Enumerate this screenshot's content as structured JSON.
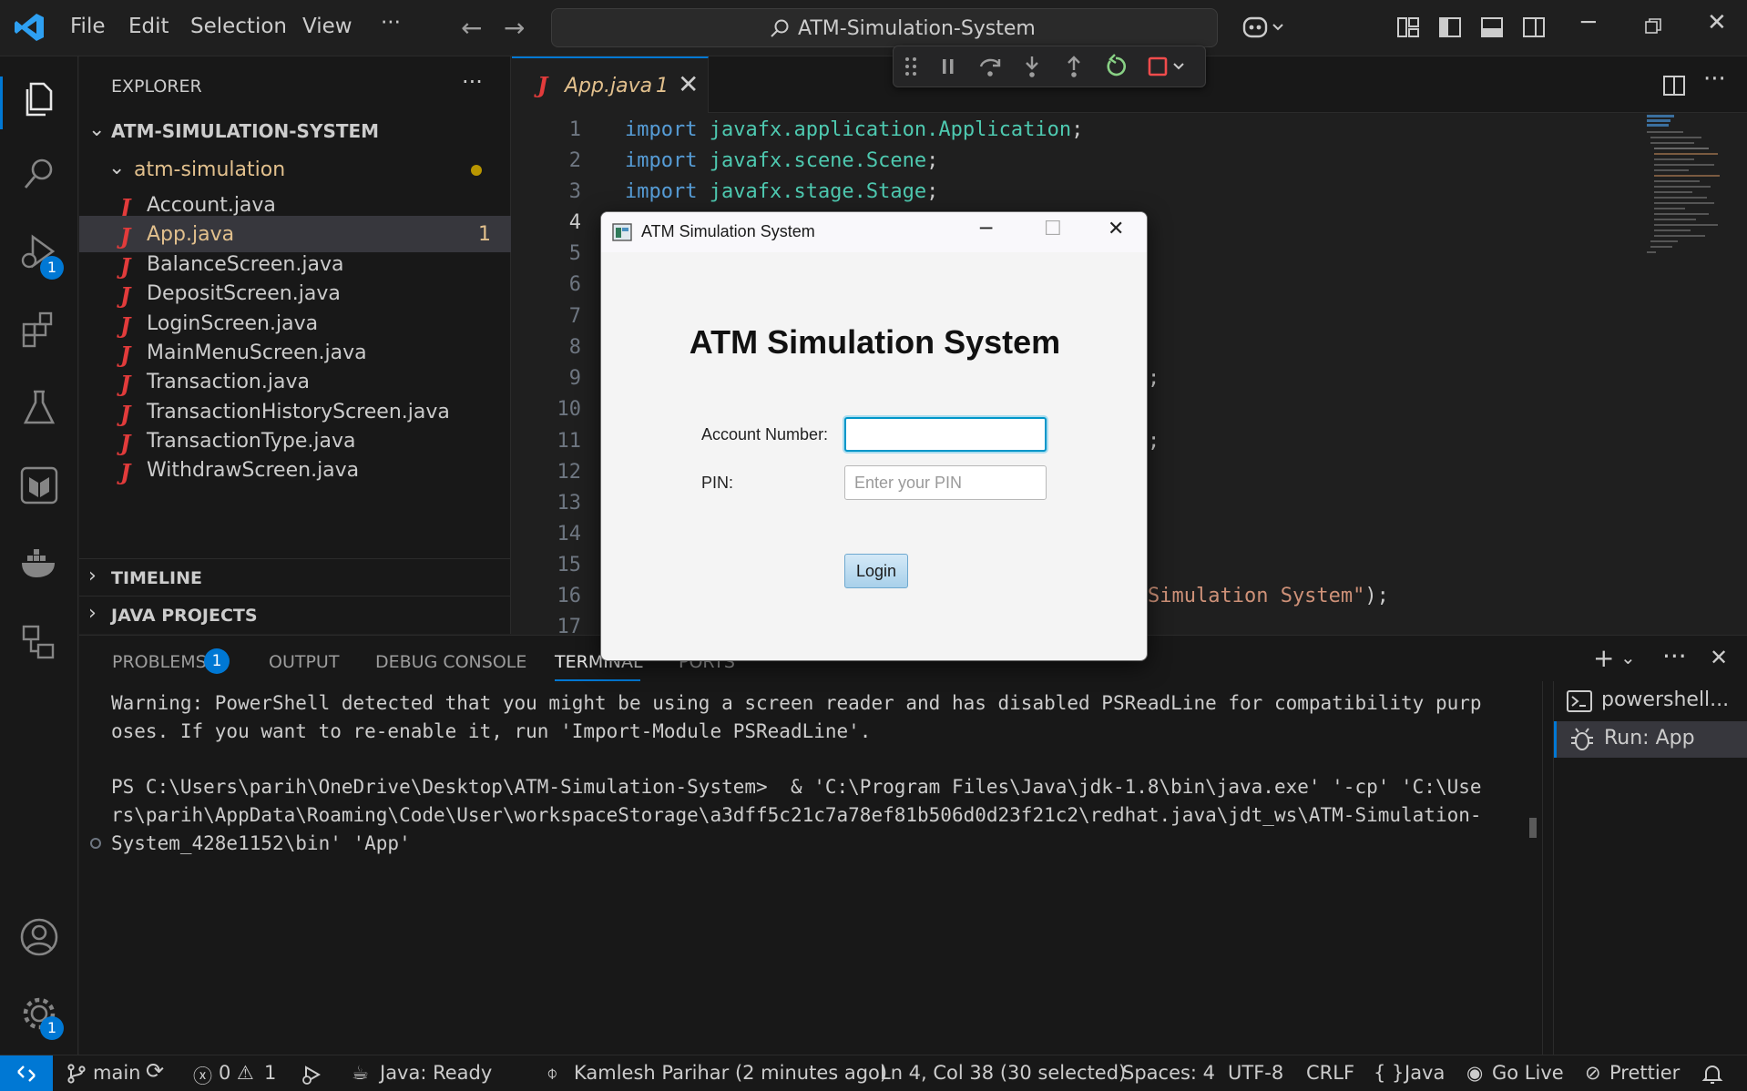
{
  "window": {
    "menu": [
      "File",
      "Edit",
      "Selection",
      "View",
      "···"
    ],
    "search_text": "ATM-Simulation-System"
  },
  "activity_bar": {
    "run_debug_badge": "1",
    "settings_badge": "1"
  },
  "explorer": {
    "title": "EXPLORER",
    "more": "···",
    "root": "ATM-SIMULATION-SYSTEM",
    "folder": "atm-simulation",
    "files": [
      {
        "name": "Account.java"
      },
      {
        "name": "App.java",
        "count": "1"
      },
      {
        "name": "BalanceScreen.java"
      },
      {
        "name": "DepositScreen.java"
      },
      {
        "name": "LoginScreen.java"
      },
      {
        "name": "MainMenuScreen.java"
      },
      {
        "name": "Transaction.java"
      },
      {
        "name": "TransactionHistoryScreen.java"
      },
      {
        "name": "TransactionType.java"
      },
      {
        "name": "WithdrawScreen.java"
      }
    ],
    "sections": [
      "TIMELINE",
      "JAVA PROJECTS"
    ]
  },
  "editor": {
    "tab_name": "App.java",
    "tab_count": "1",
    "line_numbers": [
      "1",
      "2",
      "3",
      "4",
      "5",
      "6",
      "7",
      "8",
      "9",
      "10",
      "11",
      "12",
      "13",
      "14",
      "15",
      "16",
      "17"
    ],
    "code": {
      "l1_kw": "import",
      "l1_pk": "javafx.application.Application",
      "l2_kw": "import",
      "l2_pk": "javafx.scene.Scene",
      "l3_kw": "import",
      "l3_pk": "javafx.stage.Stage",
      "semi": ";",
      "l9_frag": ";",
      "l11_frag": ";",
      "l16_str": "Simulation System\"",
      "l16_tail": ");"
    }
  },
  "dialog": {
    "title": "ATM Simulation System",
    "heading": "ATM Simulation System",
    "account_label": "Account Number:",
    "account_value": "",
    "pin_label": "PIN:",
    "pin_placeholder": "Enter your PIN",
    "login_label": "Login"
  },
  "panel": {
    "tabs": [
      "PROBLEMS",
      "OUTPUT",
      "DEBUG CONSOLE",
      "TERMINAL",
      "PORTS"
    ],
    "problems_badge": "1",
    "terminal_lines": [
      "Warning: PowerShell detected that you might be using a screen reader and has disabled PSReadLine for compatibility purp",
      "oses. If you want to re-enable it, run 'Import-Module PSReadLine'.",
      "PS C:\\Users\\parih\\OneDrive\\Desktop\\ATM-Simulation-System>  & 'C:\\Program Files\\Java\\jdk-1.8\\bin\\java.exe' '-cp' 'C:\\Use",
      "rs\\parih\\AppData\\Roaming\\Code\\User\\workspaceStorage\\a3dff5c21c7a78ef81b506d0d23f21c2\\redhat.java\\jdt_ws\\ATM-Simulation-",
      "System_428e1152\\bin' 'App'"
    ],
    "terminals": [
      "powershell...",
      "Run: App"
    ]
  },
  "status_bar": {
    "branch": "main",
    "errors": "0",
    "warnings": "1",
    "java_status": "Java: Ready",
    "blame": "Kamlesh Parihar (2 minutes ago)",
    "cursor": "Ln 4, Col 38 (30 selected)",
    "spaces": "Spaces: 4",
    "encoding": "UTF-8",
    "eol": "CRLF",
    "language": "Java",
    "golive": "Go Live",
    "prettier": "Prettier"
  },
  "colors": {
    "accent": "#0078d4",
    "java_red": "#e23b3b",
    "modified_yellow": "#e2c08d"
  }
}
